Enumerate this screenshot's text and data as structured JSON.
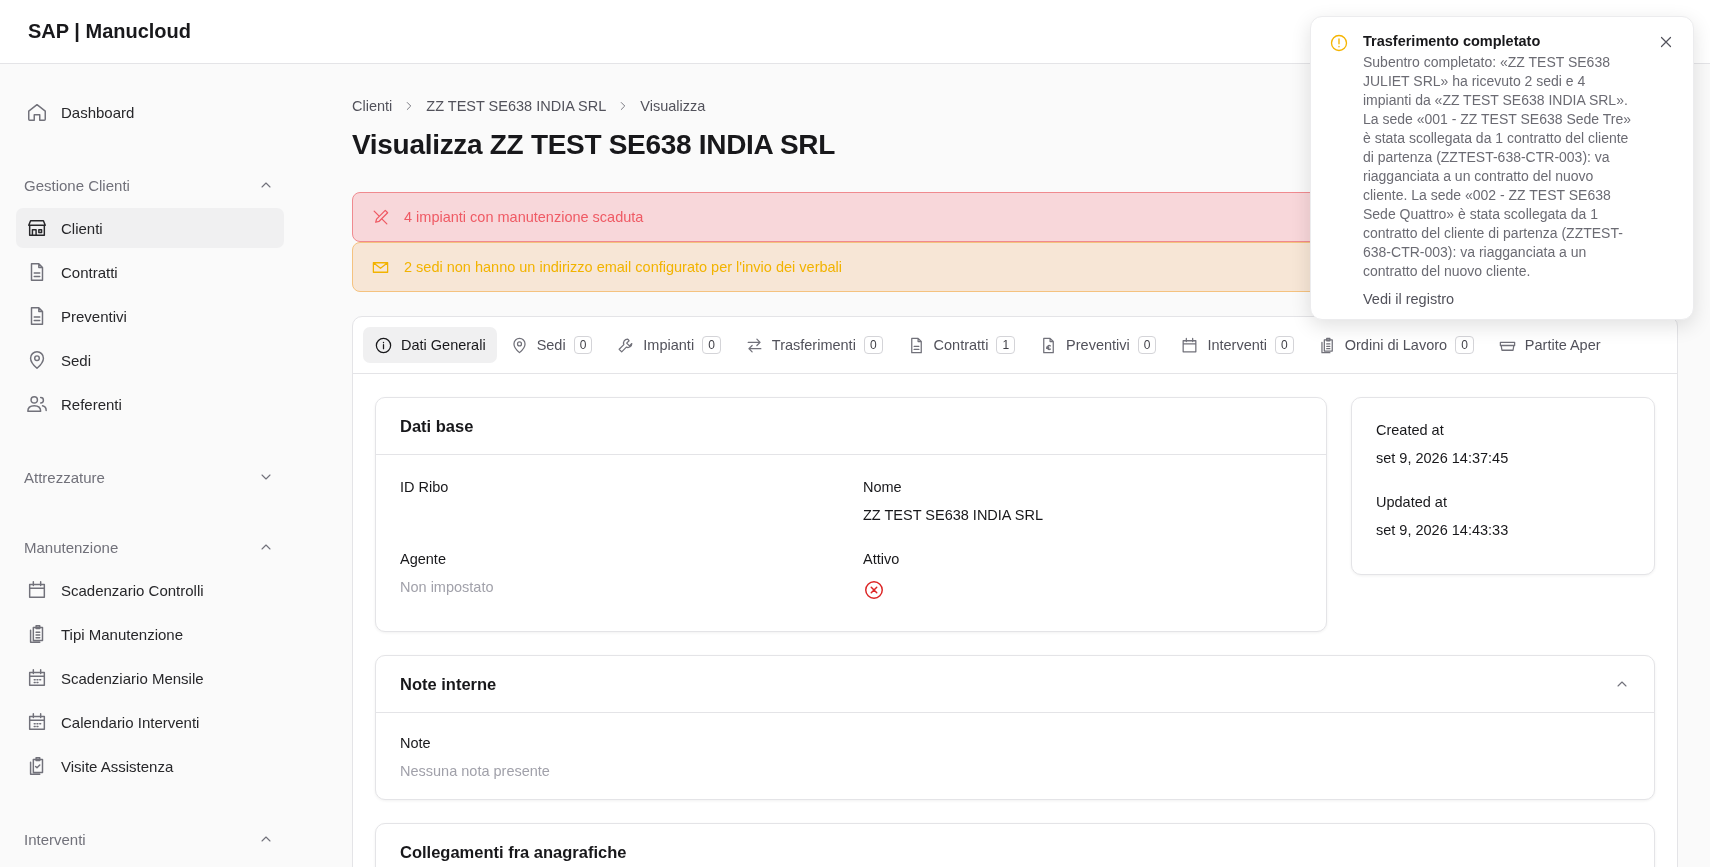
{
  "header": {
    "logo": "SAP | Manucloud"
  },
  "sidebar": {
    "items": [
      {
        "kind": "link",
        "label": "Dashboard",
        "selected": false
      },
      {
        "kind": "group",
        "label": "Gestione Clienti",
        "expanded": true,
        "children": [
          {
            "label": "Clienti",
            "selected": true
          },
          {
            "label": "Contratti",
            "selected": false
          },
          {
            "label": "Preventivi",
            "selected": false
          },
          {
            "label": "Sedi",
            "selected": false
          },
          {
            "label": "Referenti",
            "selected": false
          }
        ]
      },
      {
        "kind": "group",
        "label": "Attrezzature",
        "expanded": false
      },
      {
        "kind": "group",
        "label": "Manutenzione",
        "expanded": true,
        "children": [
          {
            "label": "Scadenzario Controlli",
            "selected": false
          },
          {
            "label": "Tipi Manutenzione",
            "selected": false
          },
          {
            "label": "Scadenziario Mensile",
            "selected": false
          },
          {
            "label": "Calendario Interventi",
            "selected": false
          },
          {
            "label": "Visite Assistenza",
            "selected": false
          }
        ]
      },
      {
        "kind": "group",
        "label": "Interventi",
        "expanded": true
      }
    ]
  },
  "breadcrumb": [
    "Clienti",
    "ZZ TEST SE638 INDIA SRL",
    "Visualizza"
  ],
  "title": "Visualizza ZZ TEST SE638 INDIA SRL",
  "alerts": [
    {
      "kind": "danger",
      "text": "4 impianti con manutenzione scaduta"
    },
    {
      "kind": "warning",
      "text": "2 sedi non hanno un indirizzo email configurato per l'invio dei verbali"
    }
  ],
  "tabs": [
    {
      "label": "Dati Generali",
      "selected": true
    },
    {
      "label": "Sedi",
      "count": "0",
      "selected": false
    },
    {
      "label": "Impianti",
      "count": "0",
      "selected": false
    },
    {
      "label": "Trasferimenti",
      "count": "0",
      "selected": false
    },
    {
      "label": "Contratti",
      "count": "1",
      "selected": false
    },
    {
      "label": "Preventivi",
      "count": "0",
      "selected": false
    },
    {
      "label": "Interventi",
      "count": "0",
      "selected": false
    },
    {
      "label": "Ordini di Lavoro",
      "count": "0",
      "selected": false
    },
    {
      "label": "Partite Aper",
      "selected": false
    }
  ],
  "base_card": {
    "title": "Dati base",
    "fields": [
      {
        "kind": "text",
        "label": "ID Ribo"
      },
      {
        "kind": "text",
        "label": "Nome",
        "value": "ZZ TEST SE638 INDIA SRL"
      },
      {
        "kind": "text",
        "label": "Agente",
        "empty_text": "Non impostato"
      },
      {
        "kind": "boolean",
        "label": "Attivo",
        "on": false
      }
    ]
  },
  "meta_card": {
    "fields": [
      {
        "label": "Created at",
        "value": "set 9, 2026 14:37:45"
      },
      {
        "label": "Updated at",
        "value": "set 9, 2026 14:43:33"
      }
    ]
  },
  "notes_card": {
    "title": "Note interne",
    "expanded": true,
    "fields": [
      {
        "label": "Note",
        "empty_text": "Nessuna nota presente"
      }
    ]
  },
  "links_card": {
    "title": "Collegamenti fra anagrafiche"
  },
  "toast": {
    "kind": "warning",
    "title": "Trasferimento completato",
    "message": "Subentro completato: «ZZ TEST SE638 JULIET SRL» ha ricevuto 2 sedi e 4 impianti da «ZZ TEST SE638 INDIA SRL». La sede «001 - ZZ TEST SE638 Sede Tre» è stata scollegata da 1 contratto del cliente di partenza (ZZTEST-638-CTR-003): va riagganciata a un contratto del nuovo cliente. La sede «002 - ZZ TEST SE638 Sede Quattro» è stata scollegata da 1 contratto del cliente di partenza (ZZTEST-638-CTR-003): va riagganciata a un contratto del nuovo cliente.",
    "link": "Vedi il registro"
  }
}
